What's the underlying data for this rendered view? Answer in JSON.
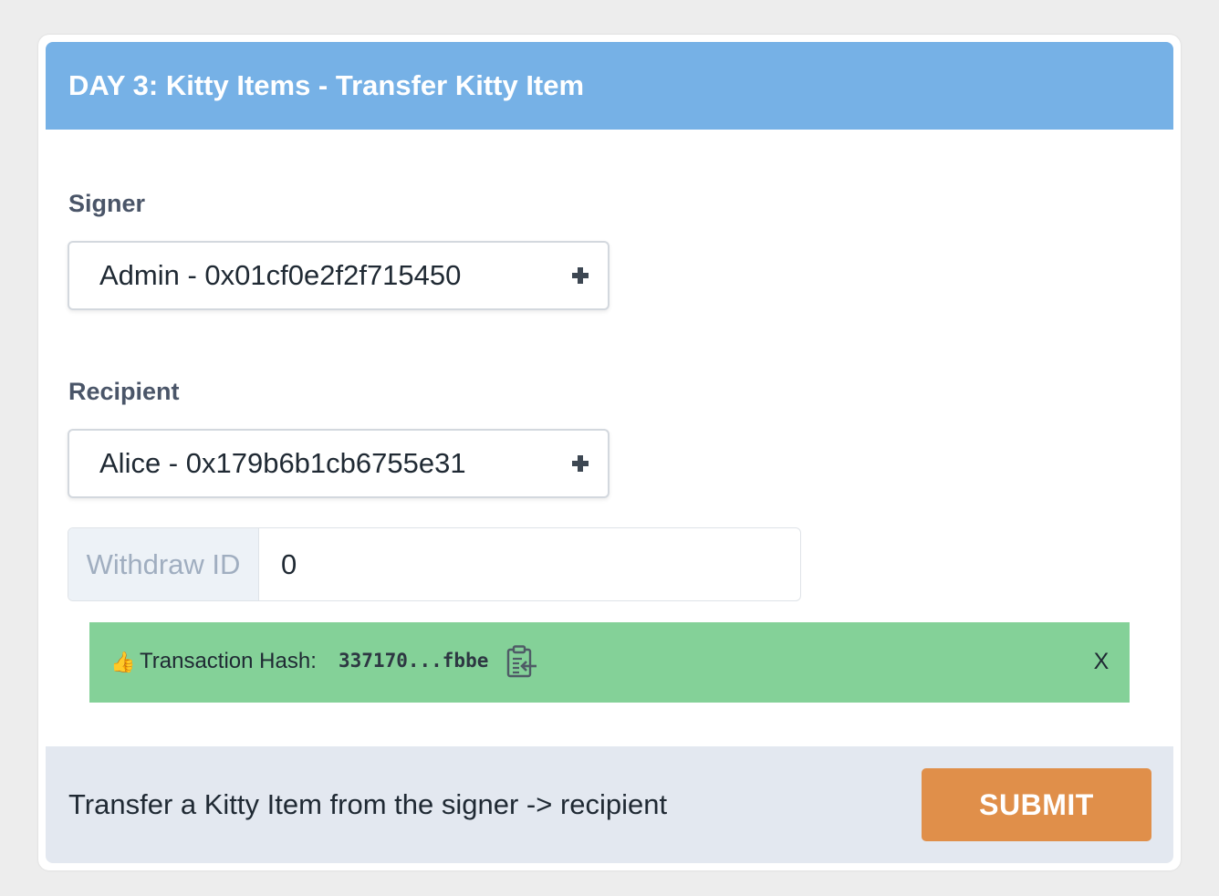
{
  "header": {
    "title": "DAY 3: Kitty Items - Transfer Kitty Item"
  },
  "signer": {
    "label": "Signer",
    "value": "Admin - 0x01cf0e2f2f715450",
    "icon": "plus-icon"
  },
  "recipient": {
    "label": "Recipient",
    "value": "Alice - 0x179b6b1cb6755e31",
    "icon": "plus-icon"
  },
  "withdraw": {
    "addon_label": "Withdraw ID",
    "value": "0"
  },
  "alert": {
    "emoji": "👍",
    "label": "Transaction Hash:",
    "hash": "337170...fbbe",
    "copy_icon": "clipboard-icon",
    "close_label": "X",
    "color": "#84d198"
  },
  "footer": {
    "description": "Transfer a Kitty Item from the signer -> recipient",
    "submit_label": "SUBMIT"
  },
  "colors": {
    "header_bg": "#76b1e6",
    "footer_bg": "#e3e8f0",
    "submit_bg": "#e08f4a",
    "page_bg": "#ededed"
  }
}
